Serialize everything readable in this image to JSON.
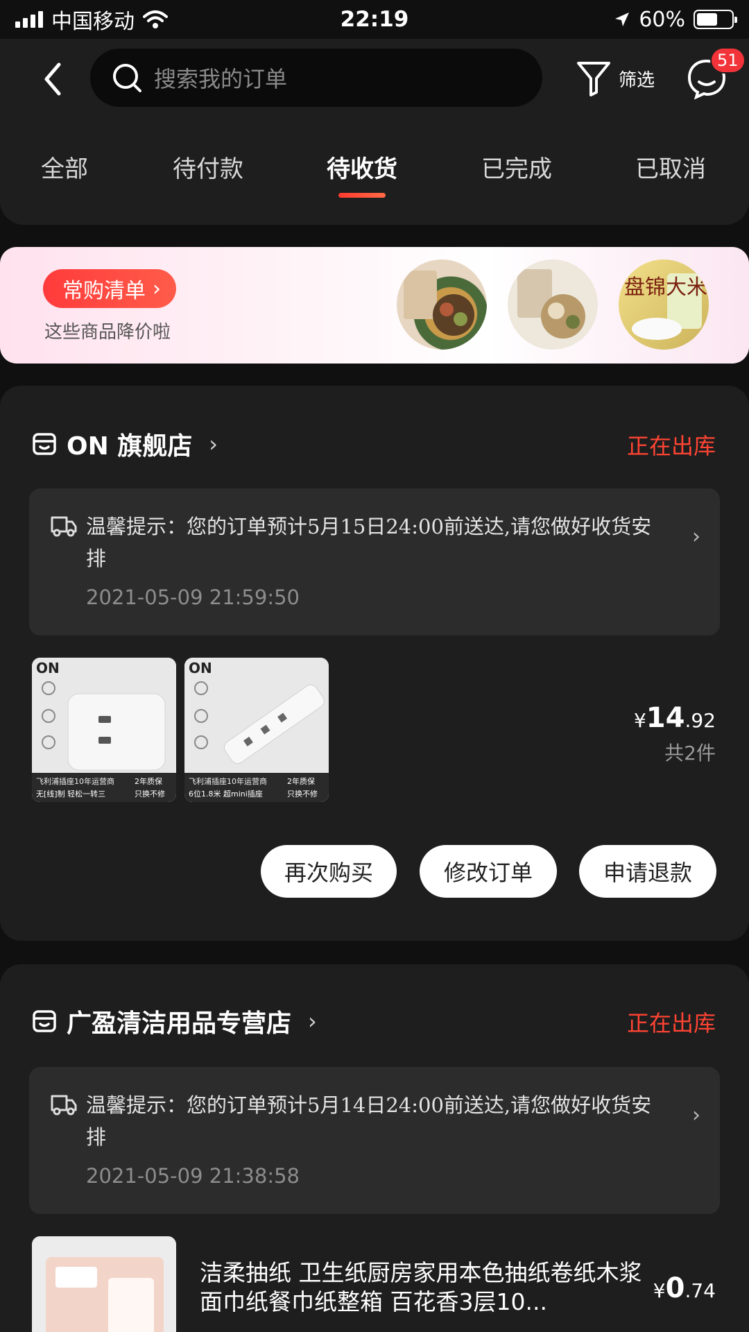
{
  "status_bar": {
    "carrier": "中国移动",
    "time": "22:19",
    "battery": "60%",
    "battery_level": 0.6
  },
  "header": {
    "search_placeholder": "搜索我的订单",
    "filter_label": "筛选",
    "message_badge": "51"
  },
  "tabs": [
    {
      "label": "全部"
    },
    {
      "label": "待付款"
    },
    {
      "label": "待收货"
    },
    {
      "label": "已完成"
    },
    {
      "label": "已取消"
    }
  ],
  "active_tab": "待收货",
  "promo": {
    "pill_label": "常购清单",
    "subtitle": "这些商品降价啦",
    "thumb_text": "盘锦大米"
  },
  "orders": [
    {
      "store_name": "ON 旗舰店",
      "status": "正在出库",
      "tip": "温馨提示：您的订单预计5月15日24:00前送达,请您做好收货安排",
      "time": "2021-05-09 21:59:50",
      "products": [
        {
          "brand": "ON",
          "caption_top": "飞利浦插座10年运营商",
          "caption_badge": "2年质保",
          "caption_bottom": "无[线]制 轻松一转三",
          "caption_bottom_right": "只换不修"
        },
        {
          "brand": "ON",
          "caption_top": "飞利浦插座10年运营商",
          "caption_badge": "2年质保",
          "caption_bottom": "6位1.8米 超mini插座",
          "caption_bottom_right": "只换不修"
        }
      ],
      "price_symbol": "¥",
      "price_int": "14",
      "price_dec": ".92",
      "count": "共2件",
      "buttons": [
        "再次购买",
        "修改订单",
        "申请退款"
      ]
    },
    {
      "store_name": "广盈清洁用品专营店",
      "status": "正在出库",
      "tip": "温馨提示：您的订单预计5月14日24:00前送达,请您做好收货安排",
      "time": "2021-05-09 21:38:58",
      "product_title": "洁柔抽纸 卫生纸厨房家用本色抽纸卷纸木浆面巾纸餐巾纸整箱 百花香3层10...",
      "price_symbol": "¥",
      "price_int": "0",
      "price_dec": ".74"
    }
  ],
  "colors": {
    "accent": "#ff4433",
    "badge": "#f2343a",
    "card": "#1e1e1e",
    "tip_bg": "#2c2c2c"
  }
}
